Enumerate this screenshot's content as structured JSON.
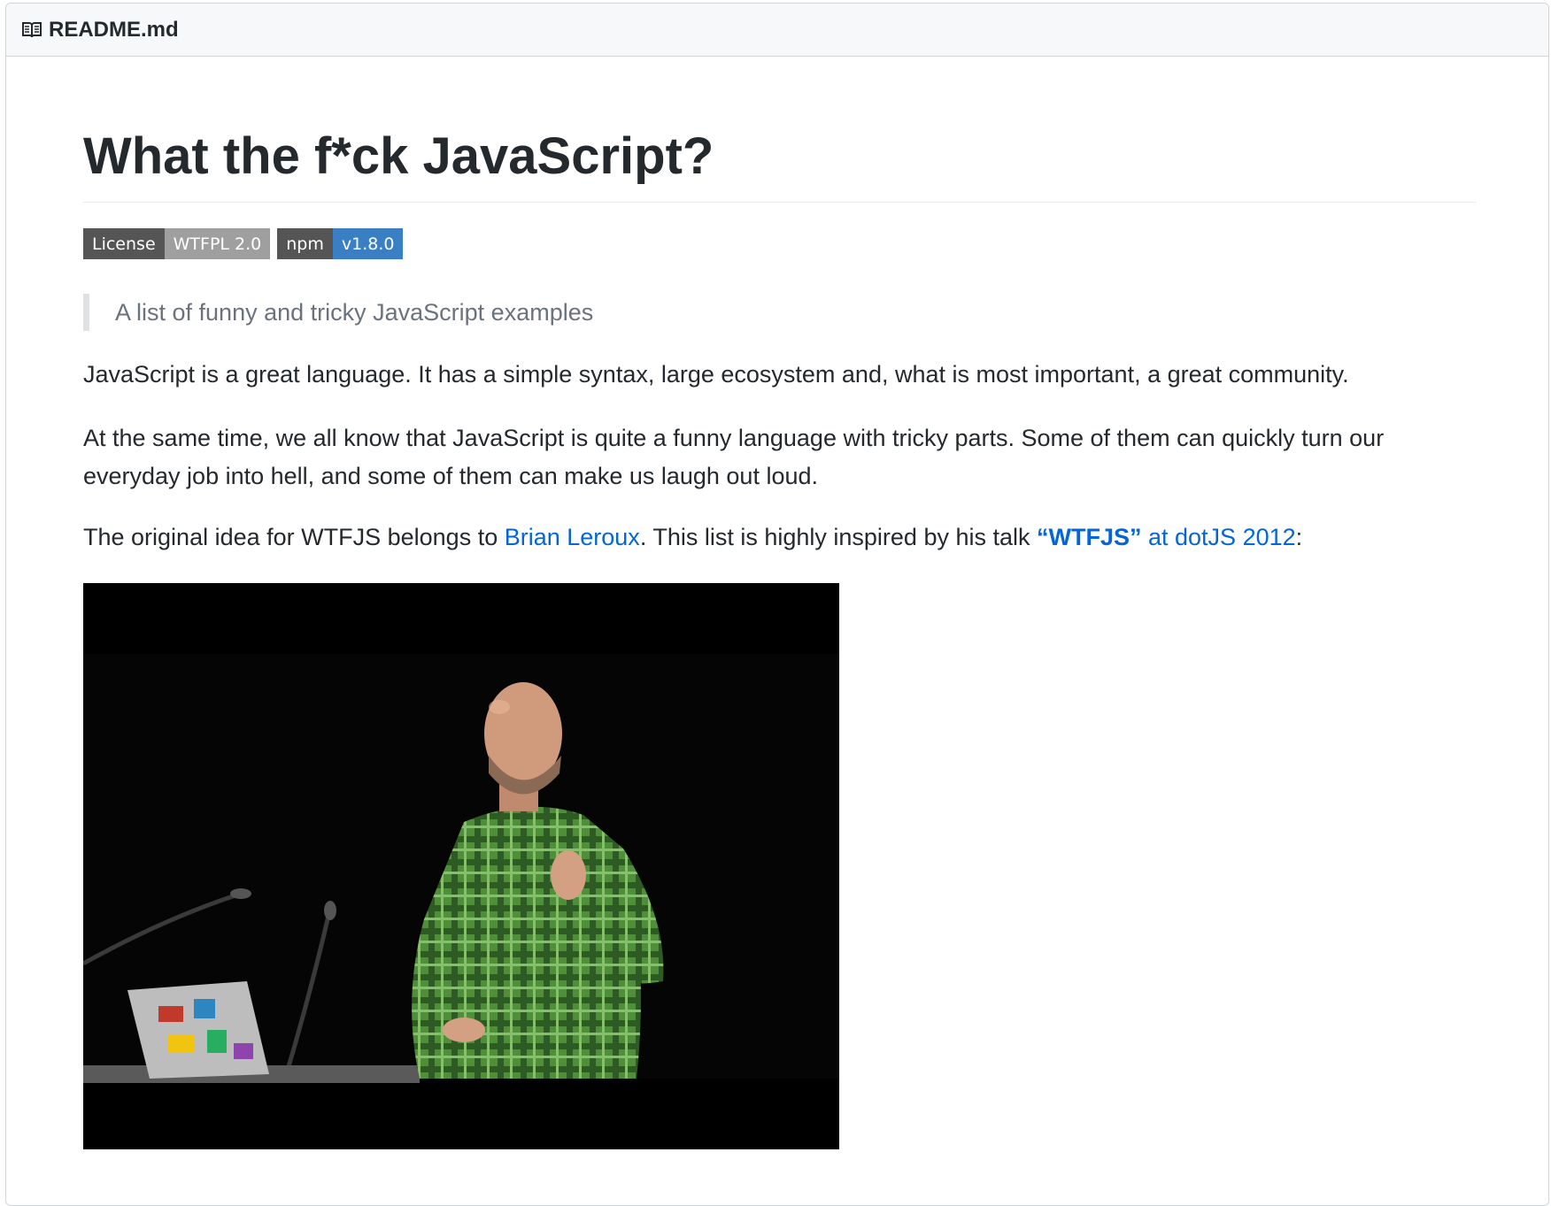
{
  "header": {
    "filename": "README.md",
    "icon": "book-icon"
  },
  "article": {
    "title": "What the f*ck JavaScript?",
    "badges": [
      {
        "key": "License",
        "value": "WTFPL 2.0",
        "color": "#9f9f9f"
      },
      {
        "key": "npm",
        "value": "v1.8.0",
        "color": "#3a7fc4"
      }
    ],
    "blockquote": "A list of funny and tricky JavaScript examples",
    "paragraph1": "JavaScript is a great language. It has a simple syntax, large ecosystem and, what is most important, a great community.",
    "paragraph2": "At the same time, we all know that JavaScript is quite a funny language with tricky parts. Some of them can quickly turn our everyday job into hell, and some of them can make us laugh out loud.",
    "paragraph3": {
      "before": "The original idea for WTFJS belongs to ",
      "author_link": "Brian Leroux",
      "middle": ". This list is highly inspired by his talk ",
      "talk_link_bold": "“WTFJS”",
      "talk_link_rest": " at dotJS 2012",
      "after": ":"
    }
  },
  "colors": {
    "link": "#0366d6",
    "text": "#24292e",
    "muted": "#6a737d",
    "header_bg": "#f6f8fa",
    "border": "#d1d5da"
  }
}
